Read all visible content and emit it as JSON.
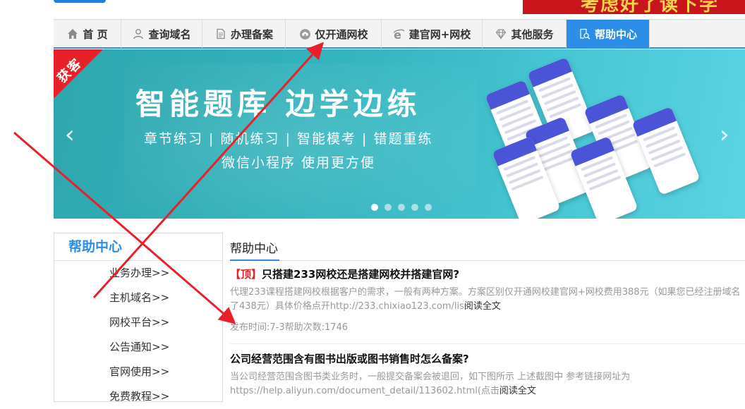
{
  "top_banner": {
    "text": "考虑好了读下学"
  },
  "nav": {
    "items": [
      {
        "label": "首 页",
        "icon": "home-icon"
      },
      {
        "label": "查询域名",
        "icon": "user-icon"
      },
      {
        "label": "办理备案",
        "icon": "document-icon"
      },
      {
        "label": "仅开通网校",
        "icon": "school-icon"
      },
      {
        "label": "建官网+网校",
        "icon": "browser-e-icon"
      },
      {
        "label": "其他服务",
        "icon": "diamond-icon"
      },
      {
        "label": "帮助中心",
        "icon": "search-doc-icon",
        "active": true
      }
    ]
  },
  "banner": {
    "ribbon": "获客",
    "title": "智能题库 边学边练",
    "subtitle1": "章节练习 | 随机练习 | 智能模考 | 错题重练",
    "subtitle2": "微信小程序 使用更方便",
    "slides": 5,
    "active_slide": 1
  },
  "sidebar": {
    "title": "帮助中心",
    "items": [
      "业务办理>>",
      "主机域名>>",
      "网校平台>>",
      "公告通知>>",
      "官网使用>>",
      "免费教程>>"
    ]
  },
  "content": {
    "heading": "帮助中心",
    "articles": [
      {
        "tag": "【顶】",
        "title": "只搭建233网校还是搭建网校并搭建官网?",
        "summary": "代理233课程搭建网校根据客户的需求，一般有两种方案。方案区别仅开通网校建官网+网校费用388元（如果您已经注册域名了438元）具体价格点开http://233.chixiao123.com/lis",
        "more": "阅读全文",
        "meta": "发布时间:7-3帮助次数:1746"
      },
      {
        "tag": "",
        "title": "公司经营范围含有图书出版或图书销售时怎么备案?",
        "summary": "当公司经营范围含图书类业务时，一般提交备案会被退回，如下图所示 上述截图中 参考链接网址为https://help.aliyun.com/document_detail/113602.html(点击",
        "more": "阅读全文",
        "meta": ""
      }
    ]
  },
  "colors": {
    "accent": "#2d8ee8",
    "annotation": "#e8202a",
    "tag": "#e6212a"
  }
}
